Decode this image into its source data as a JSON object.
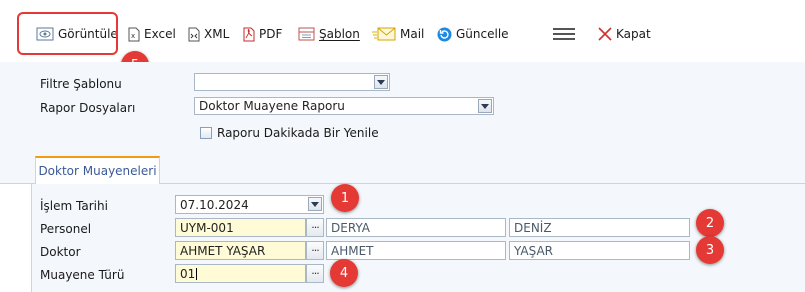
{
  "toolbar": {
    "view_label": "Görüntüle",
    "excel_label": "Excel",
    "xml_label": "XML",
    "pdf_label": "PDF",
    "template_label": "Şablon",
    "mail_label": "Mail",
    "refresh_label": "Güncelle",
    "close_label": "Kapat"
  },
  "filters": {
    "filter_template_label": "Filtre Şablonu",
    "filter_template_value": "",
    "report_files_label": "Rapor Dosyaları",
    "report_files_value": "Doktor Muayene Raporu",
    "refresh_minute_label": "Raporu Dakikada Bir Yenile"
  },
  "tabs": {
    "active": "Doktor Muayeneleri"
  },
  "form": {
    "date_label": "İşlem Tarihi",
    "date_value": "07.10.2024",
    "personnel_label": "Personel",
    "personnel_code": "UYM-001",
    "personnel_first": "DERYA",
    "personnel_last": "DENİZ",
    "doctor_label": "Doktor",
    "doctor_code": "AHMET YAŞAR",
    "doctor_first": "AHMET",
    "doctor_last": "YAŞAR",
    "type_label": "Muayene Türü",
    "type_value": "01",
    "lookup_glyph": "···"
  },
  "badges": {
    "b1": "1",
    "b2": "2",
    "b3": "3",
    "b4": "4",
    "b5": "5"
  },
  "colors": {
    "accent_red": "#e53935",
    "tab_accent": "#f39c12",
    "highlight_input": "#fffbd6"
  }
}
